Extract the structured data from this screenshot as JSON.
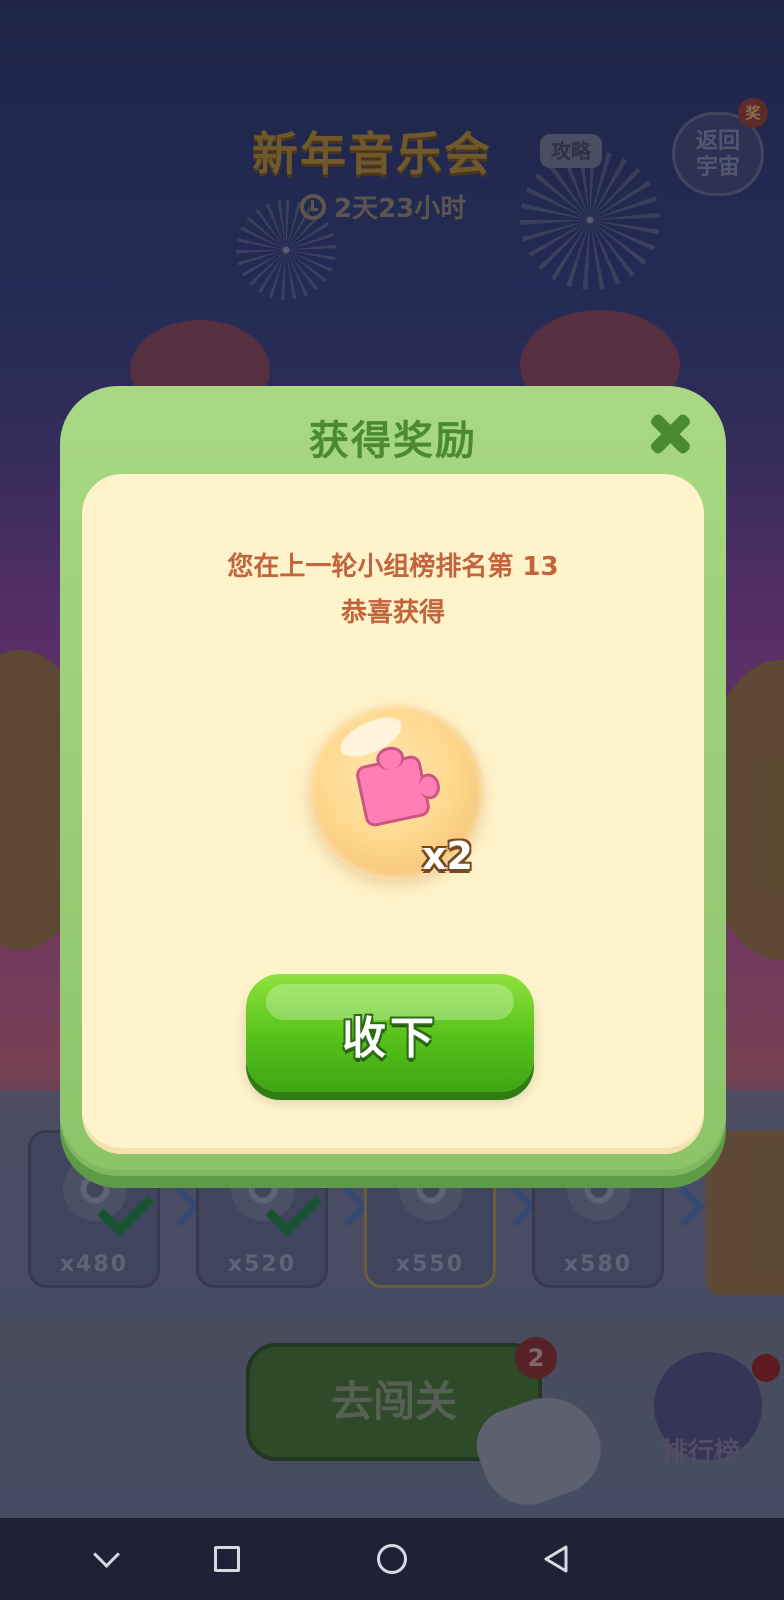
{
  "event": {
    "title": "新年音乐会",
    "guide_label": "攻略",
    "countdown": "2天23小时",
    "back_to_universe": "返回\n宇宙",
    "back_badge": "奖"
  },
  "progress": {
    "stages": [
      {
        "amount": "x480",
        "done": true
      },
      {
        "amount": "x520",
        "done": true
      },
      {
        "amount": "x550",
        "done": false
      },
      {
        "amount": "x580",
        "done": false
      }
    ]
  },
  "play": {
    "button_label": "去闯关",
    "badge_count": "2",
    "leaderboard_label": "排行榜"
  },
  "reward_dialog": {
    "title": "获得奖励",
    "message_line1": "您在上一轮小组榜排名第 13",
    "message_line2": "恭喜获得",
    "reward_item": {
      "icon": "puzzle-piece-icon",
      "quantity": "x2"
    },
    "collect_label": "收下"
  },
  "colors": {
    "dialog_green": "#9fd47b",
    "panel_cream": "#fff3cb",
    "message_text": "#c4643c",
    "button_green": "#55c11a"
  }
}
